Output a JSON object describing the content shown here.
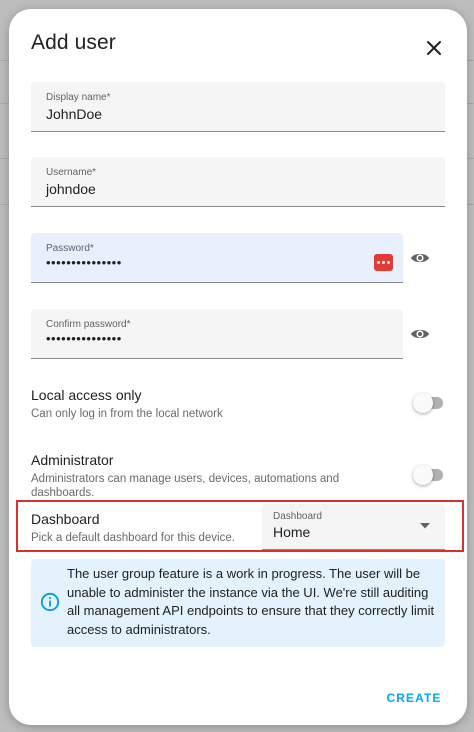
{
  "dialog": {
    "title": "Add user",
    "close_icon": "close-icon"
  },
  "fields": {
    "display_name": {
      "label": "Display name*",
      "value": "JohnDoe"
    },
    "username": {
      "label": "Username*",
      "value": "johndoe"
    },
    "password": {
      "label": "Password*",
      "value": "•••••••••••••••",
      "icon": "password-manager-key-icon"
    },
    "confirm_password": {
      "label": "Confirm password*",
      "value": "•••••••••••••••"
    }
  },
  "toggles": {
    "local_access": {
      "title": "Local access only",
      "description": "Can only log in from the local network",
      "checked": false
    },
    "administrator": {
      "title": "Administrator",
      "description_line1": "Administrators can manage users, devices, automations and",
      "description_line2": "dashboards.",
      "checked": false
    }
  },
  "dashboard": {
    "title": "Dashboard",
    "description": "Pick a default dashboard for this device.",
    "select_label": "Dashboard",
    "selected": "Home"
  },
  "info": {
    "text": "The user group feature is a work in progress. The user will be unable to administer the instance via the UI. We're still auditing all management API endpoints to ensure that they correctly limit access to administrators."
  },
  "actions": {
    "create_label": "CREATE"
  },
  "colors": {
    "accent": "#03a9f4",
    "highlight_border": "#d9302c",
    "info_background": "#e3f2fd",
    "autofill_background": "#e8f0fe"
  }
}
